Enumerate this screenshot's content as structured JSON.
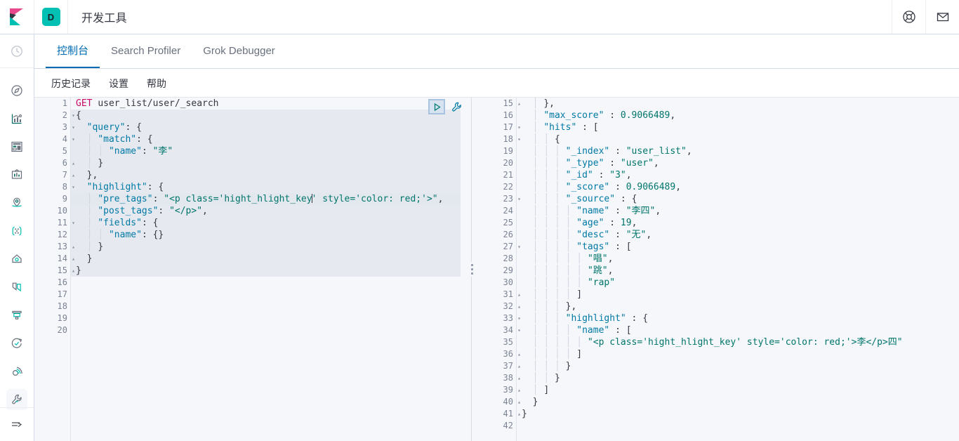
{
  "header": {
    "logo_name": "kibana-logo",
    "space_badge": "D",
    "title": "开发工具",
    "help_icon": "help-lifebuoy-icon",
    "mail_icon": "mail-envelope-icon"
  },
  "sidebar": {
    "items": [
      {
        "icon": "recently-viewed-clock-icon",
        "name": "recently-viewed"
      },
      {
        "icon": "discover-compass-icon",
        "name": "discover"
      },
      {
        "icon": "visualize-chart-icon",
        "name": "visualize"
      },
      {
        "icon": "dashboard-icon",
        "name": "dashboard"
      },
      {
        "icon": "canvas-icon",
        "name": "canvas"
      },
      {
        "icon": "maps-marker-icon",
        "name": "maps"
      },
      {
        "icon": "machine-learning-icon",
        "name": "machine-learning"
      },
      {
        "icon": "infrastructure-icon",
        "name": "infrastructure"
      },
      {
        "icon": "logs-icon",
        "name": "logs"
      },
      {
        "icon": "apm-icon",
        "name": "apm"
      },
      {
        "icon": "uptime-icon",
        "name": "uptime"
      },
      {
        "icon": "siem-icon",
        "name": "siem"
      },
      {
        "icon": "dev-tools-wrench-icon",
        "name": "dev-tools",
        "active": true
      }
    ],
    "collapse_icon": "collapse-arrow-icon"
  },
  "tabs": [
    {
      "label": "控制台",
      "active": true
    },
    {
      "label": "Search Profiler",
      "active": false
    },
    {
      "label": "Grok Debugger",
      "active": false
    }
  ],
  "submenu": [
    {
      "label": "历史记录"
    },
    {
      "label": "设置"
    },
    {
      "label": "帮助"
    }
  ],
  "editor_actions": {
    "play_icon": "play-triangle-icon",
    "wrench_icon": "wrench-icon"
  },
  "splitter": {
    "name": "pane-splitter",
    "handle_icon": "drag-dots-icon"
  },
  "request_editor": {
    "name": "console-request-editor",
    "first_line": 1,
    "last_line": 20,
    "active_line": 9,
    "selection_lines": [
      2,
      15
    ],
    "lines": [
      {
        "n": 1,
        "fold": "",
        "text": "GET user_list/user/_search"
      },
      {
        "n": 2,
        "fold": "▾",
        "text": "{"
      },
      {
        "n": 3,
        "fold": "▾",
        "text": "  \"query\": {"
      },
      {
        "n": 4,
        "fold": "▾",
        "text": "    \"match\": {"
      },
      {
        "n": 5,
        "fold": "",
        "text": "      \"name\": \"李\""
      },
      {
        "n": 6,
        "fold": "▴",
        "text": "    }"
      },
      {
        "n": 7,
        "fold": "▴",
        "text": "  },"
      },
      {
        "n": 8,
        "fold": "▾",
        "text": "  \"highlight\": {"
      },
      {
        "n": 9,
        "fold": "",
        "text": "    \"pre_tags\": \"<p class='hight_hlight_key' style='color: red;'>\","
      },
      {
        "n": 10,
        "fold": "",
        "text": "    \"post_tags\": \"</p>\","
      },
      {
        "n": 11,
        "fold": "▾",
        "text": "    \"fields\": {"
      },
      {
        "n": 12,
        "fold": "",
        "text": "      \"name\": {}"
      },
      {
        "n": 13,
        "fold": "▴",
        "text": "    }"
      },
      {
        "n": 14,
        "fold": "▴",
        "text": "  }"
      },
      {
        "n": 15,
        "fold": "▴",
        "text": "}"
      },
      {
        "n": 16,
        "fold": "",
        "text": ""
      },
      {
        "n": 17,
        "fold": "",
        "text": ""
      },
      {
        "n": 18,
        "fold": "",
        "text": ""
      },
      {
        "n": 19,
        "fold": "",
        "text": ""
      },
      {
        "n": 20,
        "fold": "",
        "text": ""
      }
    ]
  },
  "response_editor": {
    "name": "console-response-editor",
    "first_line": 15,
    "last_line": 42,
    "lines": [
      {
        "n": 15,
        "fold": "▴",
        "text": "    },"
      },
      {
        "n": 16,
        "fold": "",
        "text": "    \"max_score\" : 0.9066489,"
      },
      {
        "n": 17,
        "fold": "▾",
        "text": "    \"hits\" : ["
      },
      {
        "n": 18,
        "fold": "▾",
        "text": "      {"
      },
      {
        "n": 19,
        "fold": "",
        "text": "        \"_index\" : \"user_list\","
      },
      {
        "n": 20,
        "fold": "",
        "text": "        \"_type\" : \"user\","
      },
      {
        "n": 21,
        "fold": "",
        "text": "        \"_id\" : \"3\","
      },
      {
        "n": 22,
        "fold": "",
        "text": "        \"_score\" : 0.9066489,"
      },
      {
        "n": 23,
        "fold": "▾",
        "text": "        \"_source\" : {"
      },
      {
        "n": 24,
        "fold": "",
        "text": "          \"name\" : \"李四\","
      },
      {
        "n": 25,
        "fold": "",
        "text": "          \"age\" : 19,"
      },
      {
        "n": 26,
        "fold": "",
        "text": "          \"desc\" : \"无\","
      },
      {
        "n": 27,
        "fold": "▾",
        "text": "          \"tags\" : ["
      },
      {
        "n": 28,
        "fold": "",
        "text": "            \"唱\","
      },
      {
        "n": 29,
        "fold": "",
        "text": "            \"跳\","
      },
      {
        "n": 30,
        "fold": "",
        "text": "            \"rap\""
      },
      {
        "n": 31,
        "fold": "▴",
        "text": "          ]"
      },
      {
        "n": 32,
        "fold": "▴",
        "text": "        },"
      },
      {
        "n": 33,
        "fold": "▾",
        "text": "        \"highlight\" : {"
      },
      {
        "n": 34,
        "fold": "▾",
        "text": "          \"name\" : ["
      },
      {
        "n": 35,
        "fold": "",
        "text": "            \"<p class='hight_hlight_key' style='color: red;'>李</p>四\""
      },
      {
        "n": 36,
        "fold": "▴",
        "text": "          ]"
      },
      {
        "n": 37,
        "fold": "▴",
        "text": "        }"
      },
      {
        "n": 38,
        "fold": "▴",
        "text": "      }"
      },
      {
        "n": 39,
        "fold": "▴",
        "text": "    ]"
      },
      {
        "n": 40,
        "fold": "▴",
        "text": "  }"
      },
      {
        "n": 41,
        "fold": "▴",
        "text": "}"
      },
      {
        "n": 42,
        "fold": "",
        "text": ""
      }
    ]
  },
  "colors": {
    "accent_blue": "#006bb4",
    "teal": "#00bfb3",
    "pink": "#e9478b",
    "string_green": "#00756b",
    "key_blue": "#0079a5",
    "method_pink": "#c80a68",
    "editor_bg": "#f5f7fa",
    "selection": "#e6eaf0"
  }
}
